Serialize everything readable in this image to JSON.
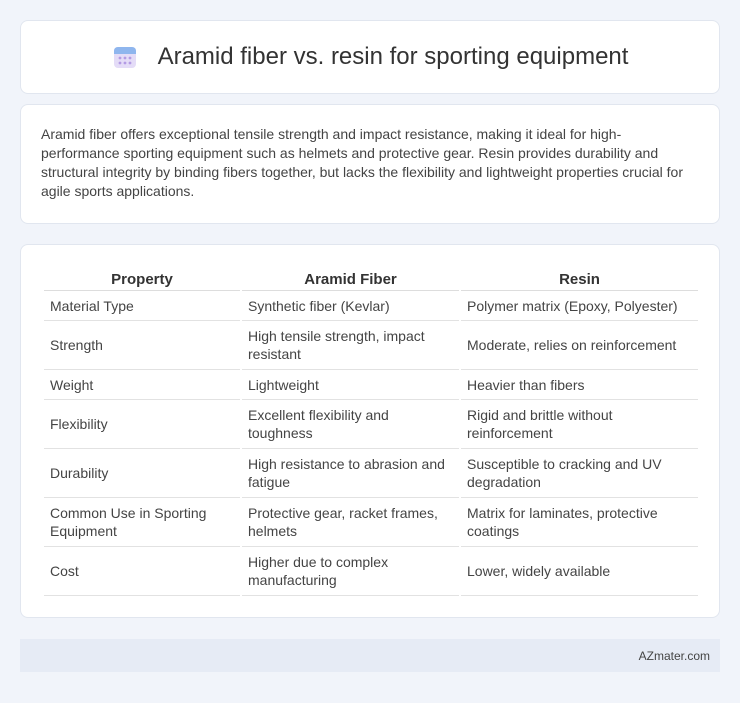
{
  "header": {
    "title": "Aramid fiber vs. resin for sporting equipment",
    "icon": "calendar-icon"
  },
  "summary": {
    "text": "Aramid fiber offers exceptional tensile strength and impact resistance, making it ideal for high-performance sporting equipment such as helmets and protective gear. Resin provides durability and structural integrity by binding fibers together, but lacks the flexibility and lightweight properties crucial for agile sports applications."
  },
  "table": {
    "headers": [
      "Property",
      "Aramid Fiber",
      "Resin"
    ],
    "rows": [
      [
        "Material Type",
        "Synthetic fiber (Kevlar)",
        "Polymer matrix (Epoxy, Polyester)"
      ],
      [
        "Strength",
        "High tensile strength, impact resistant",
        "Moderate, relies on reinforcement"
      ],
      [
        "Weight",
        "Lightweight",
        "Heavier than fibers"
      ],
      [
        "Flexibility",
        "Excellent flexibility and toughness",
        "Rigid and brittle without reinforcement"
      ],
      [
        "Durability",
        "High resistance to abrasion and fatigue",
        "Susceptible to cracking and UV degradation"
      ],
      [
        "Common Use in Sporting Equipment",
        "Protective gear, racket frames, helmets",
        "Matrix for laminates, protective coatings"
      ],
      [
        "Cost",
        "Higher due to complex manufacturing",
        "Lower, widely available"
      ]
    ]
  },
  "footer": {
    "brand": "AZmater.com"
  }
}
